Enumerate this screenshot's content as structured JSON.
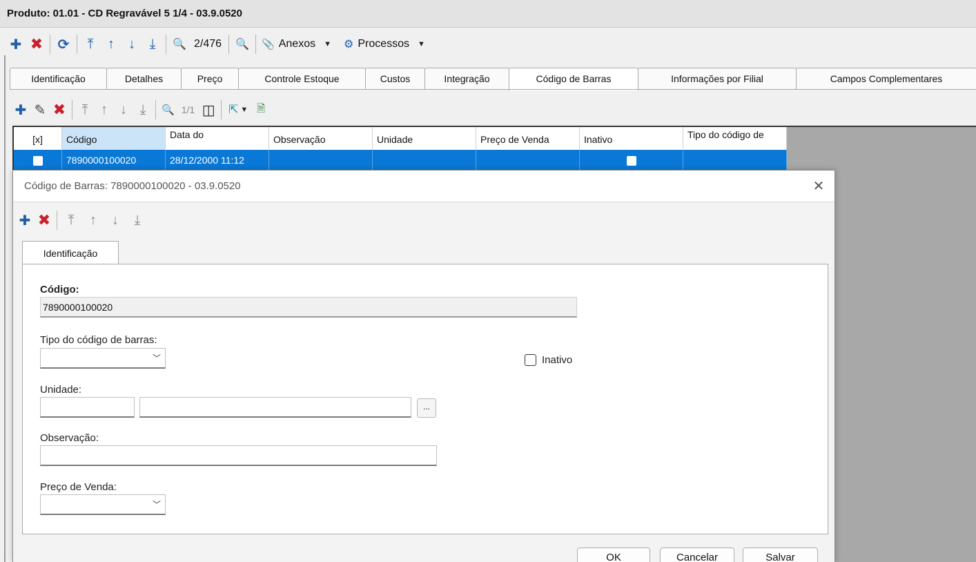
{
  "window": {
    "title": "Produto: 01.01 - CD Regravável 5 1/4 - 03.9.0520"
  },
  "main_toolbar": {
    "add": "✚",
    "delete": "✖",
    "refresh": "⟳",
    "first": "⤒",
    "prev": "↑",
    "next": "↓",
    "last": "⤓",
    "search": "🔍",
    "record_counter": "2/476",
    "advanced_search": "🔍",
    "attachments_icon": "📎",
    "attachments_label": "Anexos",
    "attachments_caret": "▼",
    "processes_icon": "⚙",
    "processes_label": "Processos",
    "processes_caret": "▼"
  },
  "tabs": [
    "Identificação",
    "Detalhes",
    "Preço",
    "Controle Estoque",
    "Custos",
    "Integração",
    "Código de Barras",
    "Informações por Filial",
    "Campos Complementares"
  ],
  "sub_toolbar": {
    "add": "✚",
    "edit": "✎",
    "delete": "✖",
    "first": "⤒",
    "prev": "↑",
    "next": "↓",
    "last": "⤓",
    "search": "🔍",
    "record_counter": "1/1",
    "columns": "◫",
    "export": "⇱",
    "export_caret": "▼",
    "report": "🗎"
  },
  "grid": {
    "columns": [
      "[x]",
      "Código",
      "Data do",
      "Observação",
      "Unidade",
      "Preço de Venda",
      "Inativo",
      "Tipo do código de"
    ],
    "rows": [
      {
        "codigo": "7890000100020",
        "data": "28/12/2000 11:12",
        "observacao": "",
        "unidade": "",
        "preco": ""
      }
    ]
  },
  "dialog": {
    "title": "Código de Barras: 7890000100020 - 03.9.0520",
    "close": "✕",
    "toolbar": {
      "add": "✚",
      "delete": "✖",
      "first": "⤒",
      "prev": "↑",
      "next": "↓",
      "last": "⤓"
    },
    "tab": "Identificação",
    "codigo_label": "Código:",
    "codigo_value": "7890000100020",
    "tipo_label": "Tipo do código de barras:",
    "tipo_value": "",
    "inativo_label": "Inativo",
    "unidade_label": "Unidade:",
    "unidade_code": "",
    "unidade_desc": "",
    "ellipsis": "...",
    "observacao_label": "Observação:",
    "observacao_value": "",
    "preco_label": "Preço de Venda:",
    "preco_value": "",
    "combo_arrow": "﹀",
    "buttons": {
      "ok": "OK",
      "cancel": "Cancelar",
      "save": "Salvar"
    }
  }
}
